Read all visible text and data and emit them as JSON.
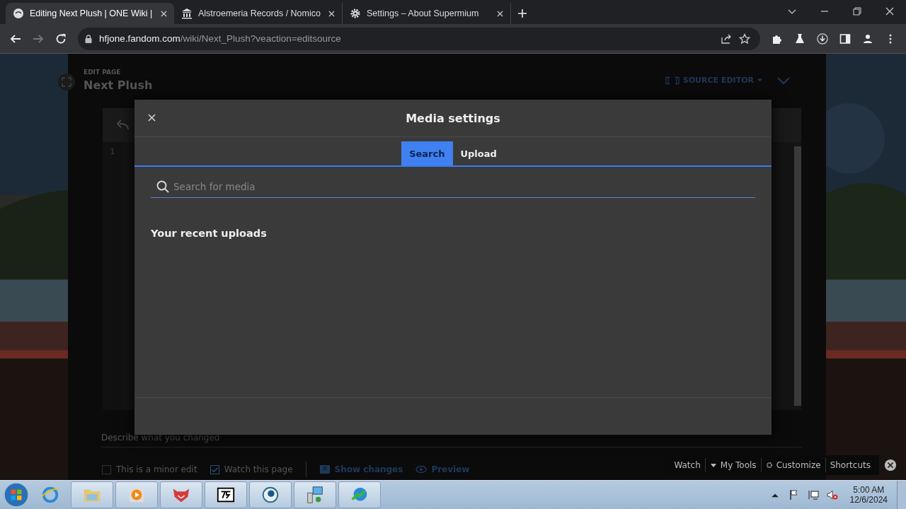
{
  "browser": {
    "tabs": [
      {
        "title": "Editing Next Plush | ONE Wiki |",
        "selected": true
      },
      {
        "title": "Alstroemeria Records / Nomico",
        "selected": false
      },
      {
        "title": "Settings – About Supermium",
        "selected": false
      }
    ],
    "address": {
      "domain": "hfjone.fandom.com",
      "path": "/wiki/Next_Plush?veaction=editsource"
    }
  },
  "editor": {
    "eyebrow": "EDIT PAGE",
    "title": "Next Plush",
    "mode": "SOURCE EDITOR",
    "line_numbers": [
      "1"
    ],
    "summary_placeholder": "Describe what you changed",
    "options": [
      {
        "label": "This is a minor edit",
        "checked": false
      },
      {
        "label": "Watch this page",
        "checked": true
      }
    ],
    "actions": [
      {
        "label": "Show changes",
        "kind": "changes"
      },
      {
        "label": "Preview",
        "kind": "preview"
      }
    ]
  },
  "modal": {
    "title": "Media settings",
    "tabs": [
      {
        "label": "Search",
        "selected": true
      },
      {
        "label": "Upload",
        "selected": false
      }
    ],
    "search": {
      "placeholder": "Search for media"
    },
    "section_heading": "Your recent uploads"
  },
  "wiki_toolbar": [
    {
      "label": "Watch",
      "kind": "plain"
    },
    {
      "label": "My Tools",
      "kind": "menu"
    },
    {
      "label": "Customize",
      "kind": "gear"
    },
    {
      "label": "Shortcuts",
      "kind": "plain"
    }
  ],
  "taskbar": {
    "time": "5:00 AM",
    "date": "12/6/2024"
  }
}
